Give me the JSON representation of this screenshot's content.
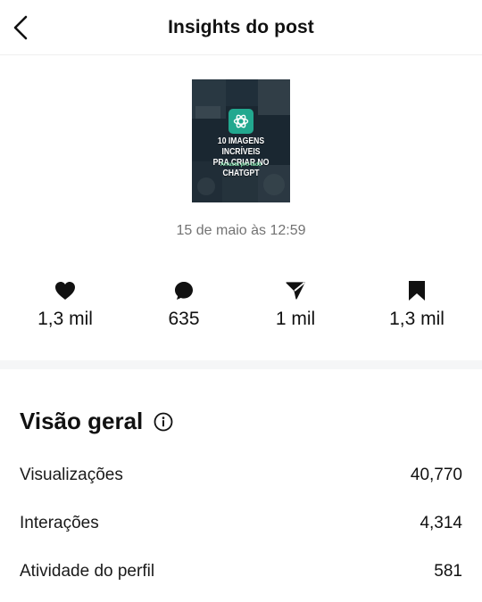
{
  "header": {
    "title": "Insights do post"
  },
  "post": {
    "thumbnail": {
      "title_line1": "10 IMAGENS INCRÍVEIS",
      "title_line2": "PRA CRIAR NO CHATGPT",
      "swipe_text": "Arrasta pro lado"
    },
    "date": "15 de maio às 12:59"
  },
  "stats": [
    {
      "icon": "heart-icon",
      "value": "1,3 mil"
    },
    {
      "icon": "comment-icon",
      "value": "635"
    },
    {
      "icon": "share-icon",
      "value": "1 mil"
    },
    {
      "icon": "bookmark-icon",
      "value": "1,3 mil"
    }
  ],
  "overview": {
    "title": "Visão geral",
    "rows": [
      {
        "label": "Visualizações",
        "value": "40,770"
      },
      {
        "label": "Interações",
        "value": "4,314"
      },
      {
        "label": "Atividade do perfil",
        "value": "581"
      }
    ]
  }
}
